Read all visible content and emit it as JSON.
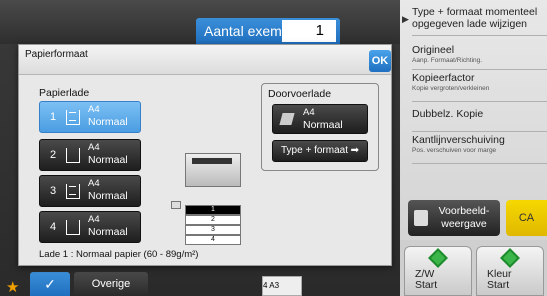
{
  "copies": {
    "label": "Aantal exempl.",
    "value": "1"
  },
  "right_panel": {
    "items": [
      {
        "main": "Type + formaat momenteel opgegeven lade wijzigen",
        "sub": ""
      },
      {
        "main": "Origineel",
        "sub": "Aanp. Formaat/Richting."
      },
      {
        "main": "Kopieerfactor",
        "sub": "Kopie vergroten/verkleinen"
      },
      {
        "main": "Dubbelz. Kopie",
        "sub": ""
      },
      {
        "main": "Kantlijnverschuiving",
        "sub": "Pos. verschuiven voor marge"
      }
    ],
    "preview_label": "Voorbeeld-weergave",
    "ca_label": "CA",
    "start_bw": {
      "line1": "Z/W",
      "line2": "Start"
    },
    "start_color": {
      "line1": "Kleur",
      "line2": "Start"
    }
  },
  "dialog": {
    "title": "Papierformaat",
    "ok_label": "OK",
    "tray_heading": "Papierlade",
    "trays": [
      {
        "num": "1",
        "size": "A4",
        "type": "Normaal",
        "selected": true
      },
      {
        "num": "2",
        "size": "A4",
        "type": "Normaal",
        "selected": false
      },
      {
        "num": "3",
        "size": "A4",
        "type": "Normaal",
        "selected": false
      },
      {
        "num": "4",
        "size": "A4",
        "type": "Normaal",
        "selected": false
      }
    ],
    "printer_trays": [
      "1",
      "2",
      "3",
      "4"
    ],
    "bypass_heading": "Doorvoerlade",
    "bypass": {
      "size": "A4",
      "type": "Normaal"
    },
    "type_format_label": "Type + formaat",
    "status": "Lade 1 : Normaal papier (60 - 89g/m²)"
  },
  "bottom": {
    "overige_label": "Overige",
    "tray_indicator": "4   A3"
  },
  "colors": {
    "accent": "#1f6fbf",
    "selected_tray": "#4a9de2",
    "start_green": "#3cb54a",
    "ca_yellow": "#f5d800"
  }
}
